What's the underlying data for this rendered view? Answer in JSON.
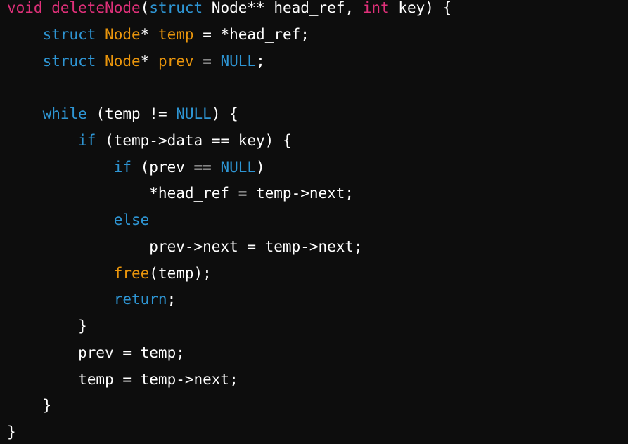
{
  "colors": {
    "background": "#0d0d0d",
    "plain": "#ffffff",
    "keyword": "#2e95d3",
    "type": "#df3079",
    "function_name": "#df3079",
    "highlight": "#e9950c"
  },
  "lines": [
    [
      {
        "cls": "type",
        "text": "void"
      },
      {
        "cls": "plain",
        "text": " "
      },
      {
        "cls": "func",
        "text": "deleteNode"
      },
      {
        "cls": "plain",
        "text": "("
      },
      {
        "cls": "kw",
        "text": "struct"
      },
      {
        "cls": "plain",
        "text": " Node** head_ref, "
      },
      {
        "cls": "type",
        "text": "int"
      },
      {
        "cls": "plain",
        "text": " key) {"
      }
    ],
    [
      {
        "cls": "plain",
        "text": "    "
      },
      {
        "cls": "kw",
        "text": "struct"
      },
      {
        "cls": "plain",
        "text": " "
      },
      {
        "cls": "ident",
        "text": "Node"
      },
      {
        "cls": "plain",
        "text": "* "
      },
      {
        "cls": "ident",
        "text": "temp"
      },
      {
        "cls": "plain",
        "text": " = *head_ref;"
      }
    ],
    [
      {
        "cls": "plain",
        "text": "    "
      },
      {
        "cls": "kw",
        "text": "struct"
      },
      {
        "cls": "plain",
        "text": " "
      },
      {
        "cls": "ident",
        "text": "Node"
      },
      {
        "cls": "plain",
        "text": "* "
      },
      {
        "cls": "ident",
        "text": "prev"
      },
      {
        "cls": "plain",
        "text": " = "
      },
      {
        "cls": "kw",
        "text": "NULL"
      },
      {
        "cls": "plain",
        "text": ";"
      }
    ],
    [],
    [
      {
        "cls": "plain",
        "text": "    "
      },
      {
        "cls": "kw",
        "text": "while"
      },
      {
        "cls": "plain",
        "text": " (temp != "
      },
      {
        "cls": "kw",
        "text": "NULL"
      },
      {
        "cls": "plain",
        "text": ") {"
      }
    ],
    [
      {
        "cls": "plain",
        "text": "        "
      },
      {
        "cls": "kw",
        "text": "if"
      },
      {
        "cls": "plain",
        "text": " (temp->data == key) {"
      }
    ],
    [
      {
        "cls": "plain",
        "text": "            "
      },
      {
        "cls": "kw",
        "text": "if"
      },
      {
        "cls": "plain",
        "text": " (prev == "
      },
      {
        "cls": "kw",
        "text": "NULL"
      },
      {
        "cls": "plain",
        "text": ")"
      }
    ],
    [
      {
        "cls": "plain",
        "text": "                *head_ref = temp->next;"
      }
    ],
    [
      {
        "cls": "plain",
        "text": "            "
      },
      {
        "cls": "kw",
        "text": "else"
      }
    ],
    [
      {
        "cls": "plain",
        "text": "                prev->next = temp->next;"
      }
    ],
    [
      {
        "cls": "plain",
        "text": "            "
      },
      {
        "cls": "ident",
        "text": "free"
      },
      {
        "cls": "plain",
        "text": "(temp);"
      }
    ],
    [
      {
        "cls": "plain",
        "text": "            "
      },
      {
        "cls": "kw",
        "text": "return"
      },
      {
        "cls": "plain",
        "text": ";"
      }
    ],
    [
      {
        "cls": "plain",
        "text": "        }"
      }
    ],
    [
      {
        "cls": "plain",
        "text": "        prev = temp;"
      }
    ],
    [
      {
        "cls": "plain",
        "text": "        temp = temp->next;"
      }
    ],
    [
      {
        "cls": "plain",
        "text": "    }"
      }
    ],
    [
      {
        "cls": "plain",
        "text": "}"
      }
    ]
  ]
}
